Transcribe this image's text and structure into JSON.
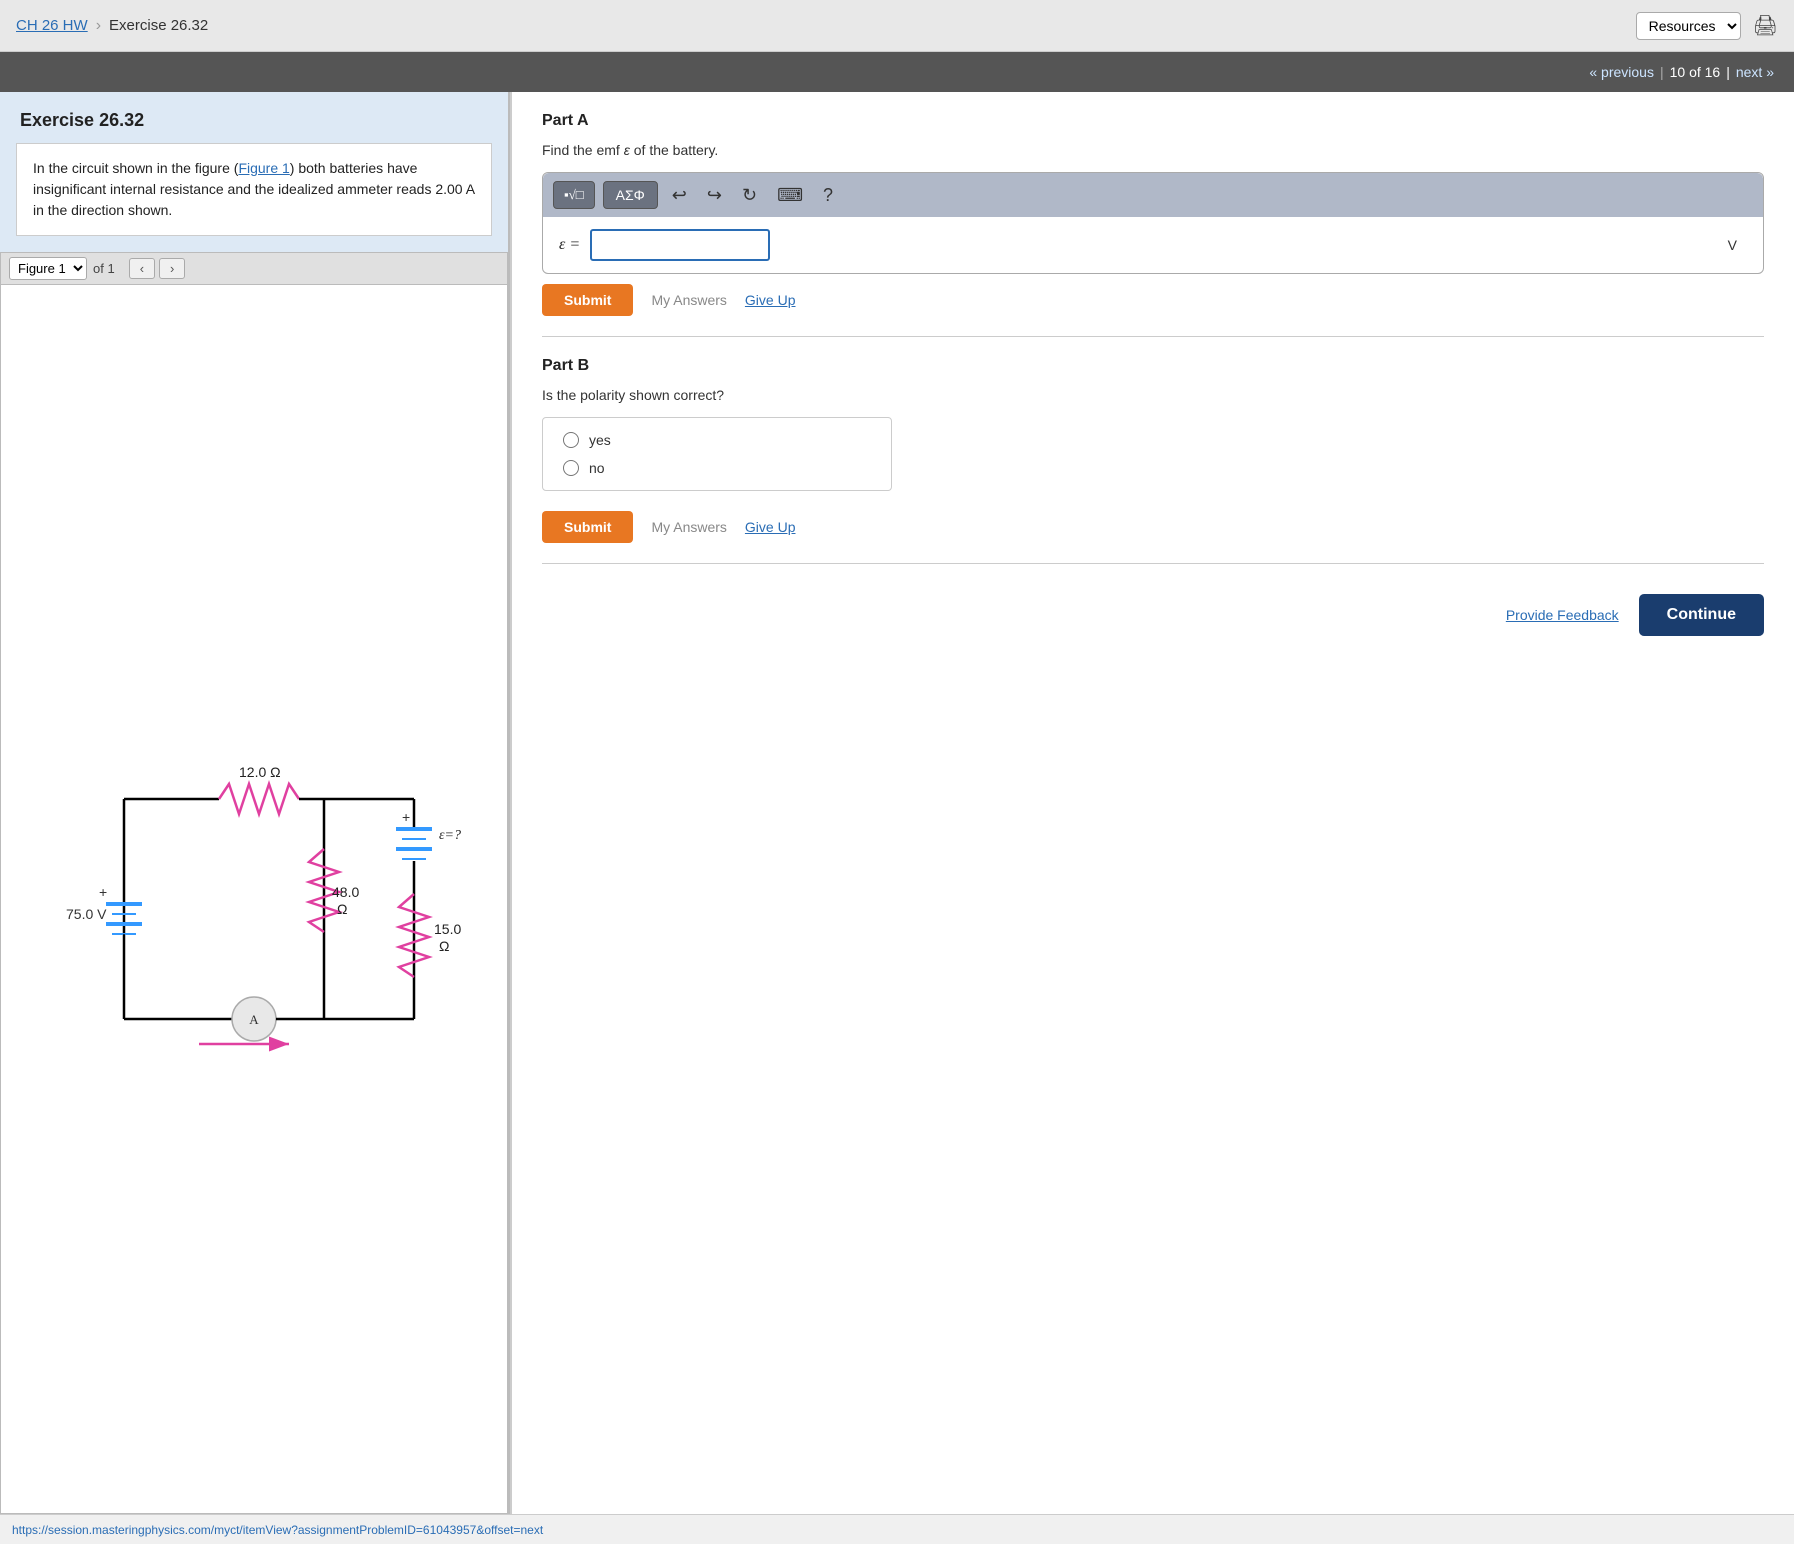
{
  "topNav": {
    "ch26Link": "CH 26 HW",
    "exerciseLabel": "Exercise 26.32",
    "resourcesLabel": "Resources",
    "printTitle": "Print"
  },
  "pagination": {
    "previous": "« previous",
    "count": "10 of 16",
    "next": "next »"
  },
  "leftPanel": {
    "exerciseTitle": "Exercise 26.32",
    "descriptionText": "In the circuit shown in the figure (",
    "figureLink": "Figure 1",
    "descriptionText2": ") both batteries have insignificant internal resistance and the idealized ammeter reads 2.00 A in the direction shown.",
    "figureLabel": "Figure 1",
    "figureOfCount": "of 1"
  },
  "rightPanel": {
    "partA": {
      "title": "Part A",
      "instruction": "Find the emf ε of the battery.",
      "toolbar": {
        "btn1": "▪√□",
        "btn2": "ΑΣΦ",
        "undo": "↩",
        "redo": "↪",
        "refresh": "↻",
        "keyboard": "⌨",
        "help": "?"
      },
      "emfLabel": "ε =",
      "emfUnit": "V",
      "submitLabel": "Submit",
      "myAnswers": "My Answers",
      "giveUp": "Give Up"
    },
    "partB": {
      "title": "Part B",
      "instruction": "Is the polarity shown correct?",
      "options": [
        "yes",
        "no"
      ],
      "submitLabel": "Submit",
      "myAnswers": "My Answers",
      "giveUp": "Give Up"
    },
    "provideFeedback": "Provide Feedback",
    "continueLabel": "Continue"
  },
  "statusBar": {
    "url": "https://session.masteringphysics.com/myct/itemView?assignmentProblemID=61043957&offset=next"
  }
}
